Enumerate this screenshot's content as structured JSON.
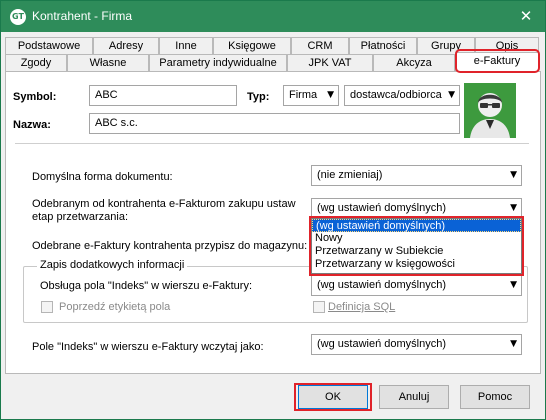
{
  "window": {
    "title": "Kontrahent - Firma",
    "app_icon_text": "GT"
  },
  "tabs_row1": [
    "Podstawowe",
    "Adresy",
    "Inne",
    "Księgowe",
    "CRM",
    "Płatności",
    "Grupy",
    "Opis"
  ],
  "tabs_row2": [
    "Zgody",
    "Własne",
    "Parametry indywidualne",
    "JPK VAT",
    "Akcyza",
    "e-Faktury"
  ],
  "active_tab": "e-Faktury",
  "header": {
    "symbol_label": "Symbol:",
    "symbol_value": "ABC",
    "typ_label": "Typ:",
    "typ_value": "Firma",
    "rola_value": "dostawca/odbiorca",
    "nazwa_label": "Nazwa:",
    "nazwa_value": "ABC s.c."
  },
  "form": {
    "domyslna_label": "Domyślna forma dokumentu:",
    "domyslna_value": "(nie zmieniaj)",
    "etap_label_line1": "Odebranym od kontrahenta e-Fakturom zakupu ustaw",
    "etap_label_line2": "etap przetwarzania:",
    "etap_value": "(wg ustawień domyślnych)",
    "etap_options": [
      "(wg ustawień domyślnych)",
      "Nowy",
      "Przetwarzany w Subiekcie",
      "Przetwarzany w księgowości"
    ],
    "etap_selected_index": 0,
    "magazyn_label": "Odebrane e-Faktury kontrahenta przypisz do magazynu:",
    "group_title": "Zapis dodatkowych informacji",
    "indeks_label": "Obsługa pola \"Indeks\" w wierszu e-Faktury:",
    "indeks_value": "(wg ustawień domyślnych)",
    "poprzedz_label": "Poprzedź etykietą pola",
    "definicja_label": "Definicja SQL",
    "wczytaj_label": "Pole \"Indeks\" w wierszu e-Faktury wczytaj jako:",
    "wczytaj_value": "(wg ustawień domyślnych)"
  },
  "buttons": {
    "ok": "OK",
    "cancel": "Anuluj",
    "help": "Pomoc"
  },
  "colors": {
    "titlebar": "#2e8c5a",
    "highlight": "#e0232a",
    "selection": "#0a62d6"
  }
}
